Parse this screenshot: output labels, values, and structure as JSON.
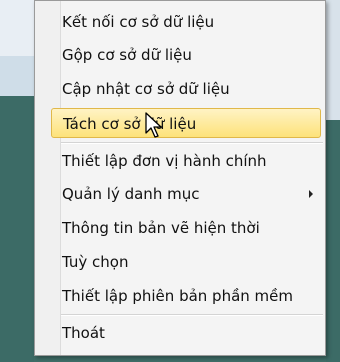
{
  "menu": {
    "items": [
      {
        "label": "Kết nối cơ sở dữ liệu"
      },
      {
        "label": "Gộp cơ sở dữ liệu"
      },
      {
        "label": "Cập nhật cơ sở dữ liệu"
      },
      {
        "label": "Tách cơ sở dữ liệu",
        "highlighted": true
      },
      {
        "label": "Thiết lập đơn vị hành chính"
      },
      {
        "label": "Quản lý danh mục",
        "has_submenu": true
      },
      {
        "label": "Thông tin bản vẽ hiện thời"
      },
      {
        "label": "Tuỳ chọn"
      },
      {
        "label": "Thiết lập phiên bản phần mềm"
      },
      {
        "label": "Thoát"
      }
    ]
  },
  "colors": {
    "highlight": "#fde27a",
    "menu_background": "#f4f4f4",
    "desktop": "#3f6e68"
  }
}
